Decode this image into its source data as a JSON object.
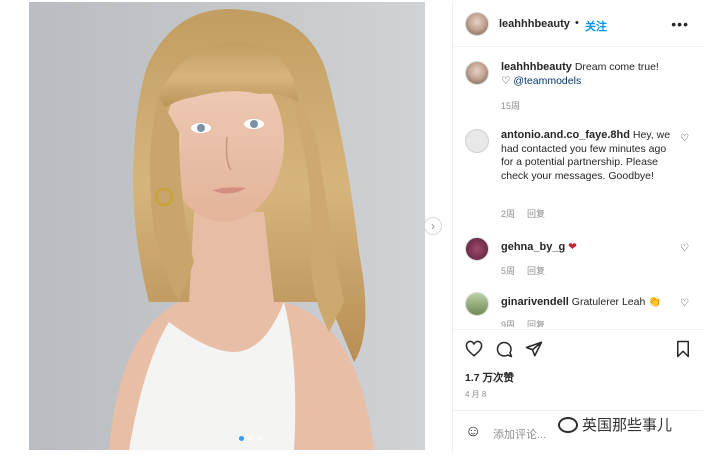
{
  "post": {
    "username": "leahhhbeauty",
    "separator": "•",
    "follow_label": "关注",
    "more_label": "•••"
  },
  "caption": {
    "username": "leahhhbeauty",
    "text": "Dream come true!",
    "heart": "♡",
    "mention": "@teammodels",
    "time": "15周"
  },
  "comments": [
    {
      "username": "antonio.and.co_faye.8hd",
      "text": "Hey, we had contacted you few minutes ago for a potential partnership. Please check your messages. Goodbye!",
      "time": "2周",
      "reply": "回复"
    },
    {
      "username": "gehna_by_g",
      "text": "❤",
      "time": "5周",
      "reply": "回复"
    },
    {
      "username": "ginarivendell",
      "text": "Gratulerer Leah 👏",
      "time": "9周",
      "reply": "回复"
    }
  ],
  "actions": {
    "like_icon": "heart-outline",
    "comment_icon": "comment-bubble",
    "share_icon": "paper-plane",
    "save_icon": "bookmark"
  },
  "likes": "1.7 万次赞",
  "date": "4 月 8",
  "add_comment": {
    "emoji": "☺",
    "placeholder": "添加评论..."
  },
  "watermark": "英国那些事儿",
  "colors": {
    "follow": "#0095f6",
    "mention": "#00376b",
    "meta": "#8e8e8e",
    "border": "#efefef"
  }
}
